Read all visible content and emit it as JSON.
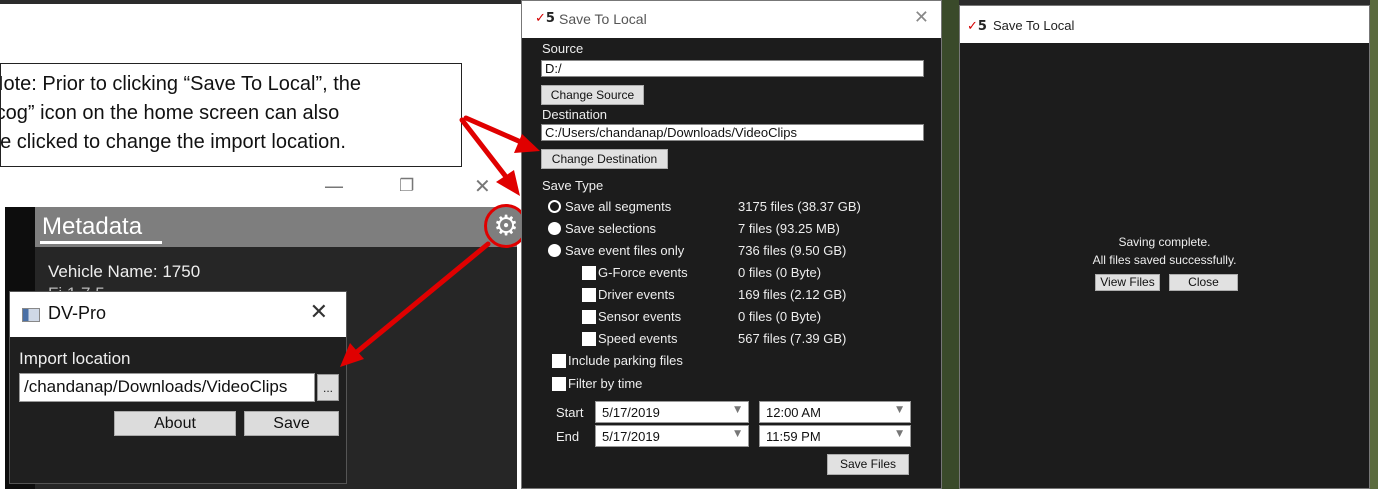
{
  "note": {
    "lines": [
      "Note: Prior to clicking “Save To Local”, the",
      "“cog” icon on the home screen can also",
      "be clicked to change the import location."
    ]
  },
  "background_window": {
    "minimize": "—",
    "maximize": "❐",
    "close": "✕"
  },
  "metadata": {
    "title": "Metadata",
    "vehicle_name": "Vehicle Name: 1750",
    "partial_line": "Fi                    1.7.5",
    "gear_icon": "⚙"
  },
  "dvpro": {
    "title": "DV-Pro",
    "close": "✕",
    "import_label": "Import location",
    "import_value": "/chandanap/Downloads/VideoClips",
    "browse": "...",
    "about": "About",
    "save": "Save"
  },
  "save_dialog": {
    "logo_check": "✓",
    "logo_text": "5",
    "title": "Save To Local",
    "close": "✕",
    "source_label": "Source",
    "source_value": "D:/",
    "change_source": "Change Source",
    "destination_label": "Destination",
    "destination_value": "C:/Users/chandanap/Downloads/VideoClips",
    "change_destination": "Change Destination",
    "save_type_label": "Save Type",
    "options": [
      {
        "label": "Save all segments",
        "count": "3175 files (38.37 GB)"
      },
      {
        "label": "Save selections",
        "count": "7 files (93.25 MB)"
      },
      {
        "label": "Save event files only",
        "count": "736 files (9.50 GB)"
      }
    ],
    "events": [
      {
        "label": "G-Force events",
        "count": "0 files (0 Byte)"
      },
      {
        "label": "Driver events",
        "count": "169 files (2.12 GB)"
      },
      {
        "label": "Sensor events",
        "count": "0 files (0 Byte)"
      },
      {
        "label": "Speed events",
        "count": "567 files (7.39 GB)"
      }
    ],
    "include_parking": "Include parking files",
    "filter_by_time": "Filter by time",
    "start_label": "Start",
    "end_label": "End",
    "start_date": "5/17/2019",
    "end_date": "5/17/2019",
    "start_time": "12:00 AM",
    "end_time": "11:59 PM",
    "save_files": "Save Files",
    "caret": "▼"
  },
  "complete_dialog": {
    "logo_check": "✓",
    "logo_text": "5",
    "title": "Save To Local",
    "message1": "Saving complete.",
    "message2": "All files saved successfully.",
    "view_files": "View Files",
    "close": "Close"
  },
  "colors": {
    "arrow": "#e00000",
    "dialog_bg": "#1c1c1c",
    "header_gray": "#7e7e7e"
  }
}
